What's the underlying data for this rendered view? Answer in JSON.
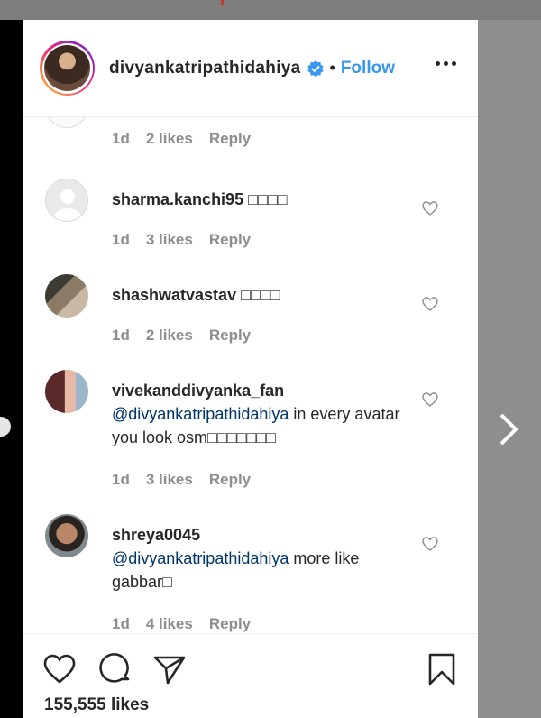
{
  "header": {
    "username": "divyankatripathidahiya",
    "separator": "•",
    "follow_label": "Follow"
  },
  "top_comment_meta": {
    "time": "1d",
    "likes": "2 likes",
    "reply": "Reply"
  },
  "comments": [
    {
      "username": "sharma.kanchi95",
      "text": "□□□□",
      "mention": "",
      "time": "1d",
      "likes": "3 likes",
      "reply": "Reply"
    },
    {
      "username": "shashwatvastav",
      "text": "□□□□",
      "mention": "",
      "time": "1d",
      "likes": "2 likes",
      "reply": "Reply"
    },
    {
      "username": "vivekanddivyanka_fan",
      "mention": "@divyankatripathidahiya",
      "text": "in every avatar you look osm□□□□□□□",
      "time": "1d",
      "likes": "3 likes",
      "reply": "Reply"
    },
    {
      "username": "shreya0045",
      "mention": "@divyankatripathidahiya",
      "text": "more like gabbar□",
      "time": "1d",
      "likes": "4 likes",
      "reply": "Reply"
    }
  ],
  "footer": {
    "likes": "155,555 likes"
  }
}
